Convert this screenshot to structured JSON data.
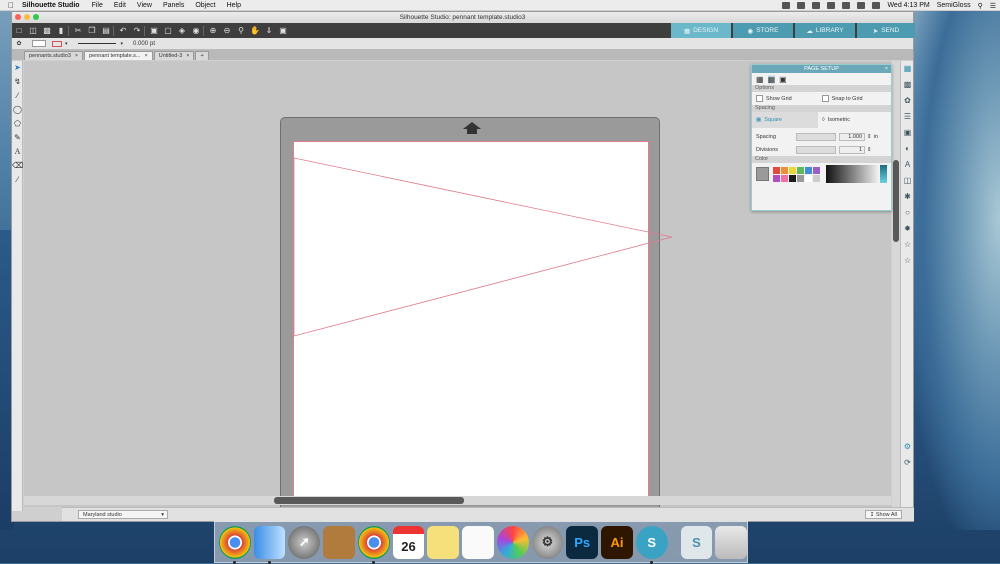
{
  "menubar": {
    "app": "Silhouette Studio",
    "items": [
      "File",
      "Edit",
      "View",
      "Panels",
      "Object",
      "Help"
    ],
    "clock": "Wed 4:13 PM",
    "user": "SemiGloss"
  },
  "window": {
    "title": "Silhouette Studio: pennant template.studio3"
  },
  "nav": {
    "design": "DESIGN",
    "store": "STORE",
    "library": "LIBRARY",
    "send": "SEND"
  },
  "optbar": {
    "line_value": "0.000",
    "unit": "pt"
  },
  "tabs": [
    {
      "label": "pennants.studio3"
    },
    {
      "label": "pennant template.s..."
    },
    {
      "label": "Untitled-3"
    }
  ],
  "panel": {
    "title": "PAGE SETUP",
    "options_header": "Options",
    "show_grid": "Show Grid",
    "snap_to_grid": "Snap to Grid",
    "spacing_header": "Spacing",
    "square": "Square",
    "isometric": "Isometric",
    "spacing_label": "Spacing",
    "spacing_value": "1.000",
    "spacing_unit": "in",
    "divisions_label": "Divisions",
    "divisions_value": "1",
    "color_header": "Color",
    "swatches": [
      "#e04b3b",
      "#e8903a",
      "#e9d63a",
      "#5fb85a",
      "#3f8fd6",
      "#9a5fc7",
      "#b14fc2",
      "#ef6fa7",
      "#1c1c1c",
      "#9a9a9a",
      "#ffffff",
      "#cccccc"
    ]
  },
  "status": {
    "library": "Maryland studio",
    "show_all": "Show All"
  },
  "dock": {
    "calendar_day": "26",
    "ps": "Ps",
    "ai": "Ai"
  },
  "colors": {
    "accent": "#6ab8c9",
    "mat": "#9a9a9a",
    "cut_line": "#e07c8c"
  }
}
